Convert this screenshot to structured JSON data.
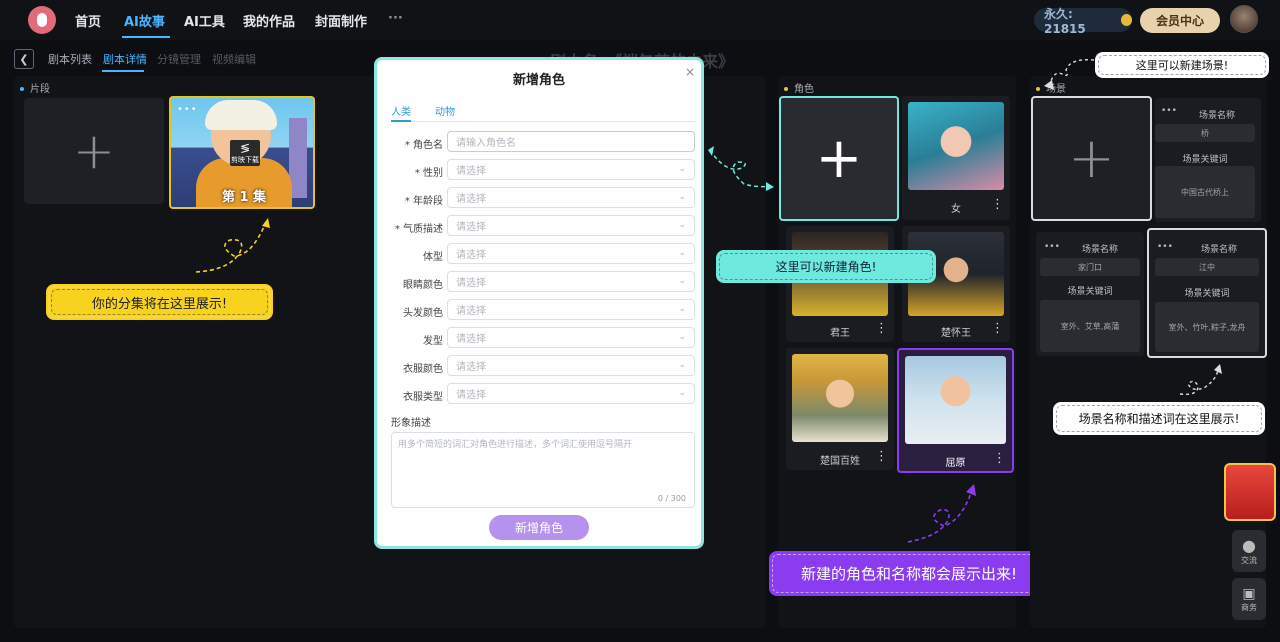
{
  "nav": {
    "items": [
      "首页",
      "AI故事",
      "AI工具",
      "我的作品",
      "封面制作",
      "···"
    ],
    "points": "永久: 21815",
    "vip": "会员中心"
  },
  "subtabs": [
    "剧本列表",
    "剧本详情",
    "分镜管理",
    "视频编辑"
  ],
  "page_title": "剧本名：《端午节的由来》",
  "sections": {
    "clips": "片段",
    "roles": "角色",
    "scenes": "场景"
  },
  "episode": {
    "title": "第 1 集",
    "logo_text": "剪映下载"
  },
  "callouts": {
    "episodes": "你的分集将在这里展示!",
    "new_role": "这里可以新建角色!",
    "new_scene": "这里可以新建场景!",
    "scene_info": "场景名称和描述词在这里展示!",
    "roles_show": "新建的角色和名称都会展示出来!"
  },
  "modal": {
    "title": "新增角色",
    "close": "×",
    "tabs": [
      "人类",
      "动物"
    ],
    "name_label": "* 角色名",
    "name_placeholder": "请输入角色名",
    "fields": [
      {
        "label": "* 性别",
        "value": "请选择"
      },
      {
        "label": "* 年龄段",
        "value": "请选择"
      },
      {
        "label": "* 气质描述",
        "value": "请选择"
      },
      {
        "label": "体型",
        "value": "请选择"
      },
      {
        "label": "眼睛颜色",
        "value": "请选择"
      },
      {
        "label": "头发颜色",
        "value": "请选择"
      },
      {
        "label": "发型",
        "value": "请选择"
      },
      {
        "label": "衣服颜色",
        "value": "请选择"
      },
      {
        "label": "衣服类型",
        "value": "请选择"
      }
    ],
    "desc_label": "形象描述",
    "desc_placeholder": "用多个简短的词汇对角色进行描述，多个词汇使用逗号隔开",
    "desc_count": "0 / 300",
    "submit": "新增角色"
  },
  "roles": [
    {
      "name": "女"
    },
    {
      "name": "君王"
    },
    {
      "name": "楚怀王"
    },
    {
      "name": "楚国百姓"
    },
    {
      "name": "屈原"
    }
  ],
  "scene_labels": {
    "name": "场景名称",
    "keywords": "场景关键词"
  },
  "scenes": [
    {
      "name": "桥",
      "keywords": "中国古代桥上"
    },
    {
      "name": "家门口",
      "keywords": "室外、艾草,高蒲"
    },
    {
      "name": "江中",
      "keywords": "室外、竹叶,粽子,龙舟"
    }
  ],
  "side": {
    "chat": "交流",
    "biz": "商务"
  },
  "colors": {
    "accent": "#48b6ff",
    "yellow": "#f7d21e",
    "cyan": "#6fe8dd",
    "purple": "#8b3cf0"
  }
}
